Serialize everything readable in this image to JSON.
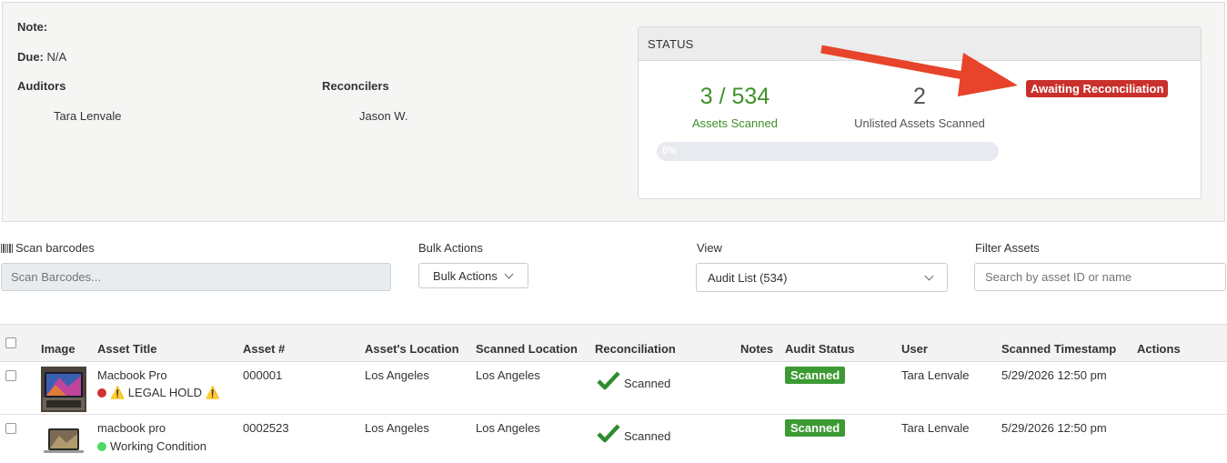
{
  "info": {
    "note_label": "Note:",
    "due_label": "Due:",
    "due_value": "N/A",
    "auditors_label": "Auditors",
    "auditor_name": "Tara Lenvale",
    "reconcilers_label": "Reconcilers",
    "reconciler_name": "Jason W."
  },
  "status": {
    "header": "STATUS",
    "scanned_count": "3 / 534",
    "scanned_label": "Assets Scanned",
    "unlisted_count": "2",
    "unlisted_label": "Unlisted Assets Scanned",
    "badge": "Awaiting Reconciliation",
    "progress": 0,
    "progress_text": "0%"
  },
  "toolbar": {
    "scan_label": "Scan barcodes",
    "scan_placeholder": "Scan Barcodes...",
    "bulk_label": "Bulk Actions",
    "bulk_button": "Bulk Actions",
    "view_label": "View",
    "view_value": "Audit List (534)",
    "filter_label": "Filter Assets",
    "filter_placeholder": "Search by asset ID or name"
  },
  "table": {
    "headers": [
      "Image",
      "Asset Title",
      "Asset #",
      "Asset's Location",
      "Scanned Location",
      "Reconciliation",
      "Notes",
      "Audit Status",
      "User",
      "Scanned Timestamp",
      "Actions"
    ],
    "rows": [
      {
        "title": "Macbook Pro",
        "tag": "⚠️ LEGAL HOLD ⚠️",
        "tag_color": "#d0312d",
        "asset_no": "000001",
        "location": "Los Angeles",
        "scanned_location": "Los Angeles",
        "reconciliation": "Scanned",
        "notes": "",
        "audit_status": "Scanned",
        "user": "Tara Lenvale",
        "timestamp": "5/29/2026 12:50 pm"
      },
      {
        "title": "macbook pro",
        "tag": "Working Condition",
        "tag_color": "#4cd964",
        "asset_no": "0002523",
        "location": "Los Angeles",
        "scanned_location": "Los Angeles",
        "reconciliation": "Scanned",
        "notes": "",
        "audit_status": "Scanned",
        "user": "Tara Lenvale",
        "timestamp": "5/29/2026 12:50 pm"
      }
    ]
  },
  "colors": {
    "accent_green": "#3f8f29",
    "badge_red": "#c9302c",
    "arrow_red": "#e8432b",
    "status_green": "#3c9a33"
  }
}
